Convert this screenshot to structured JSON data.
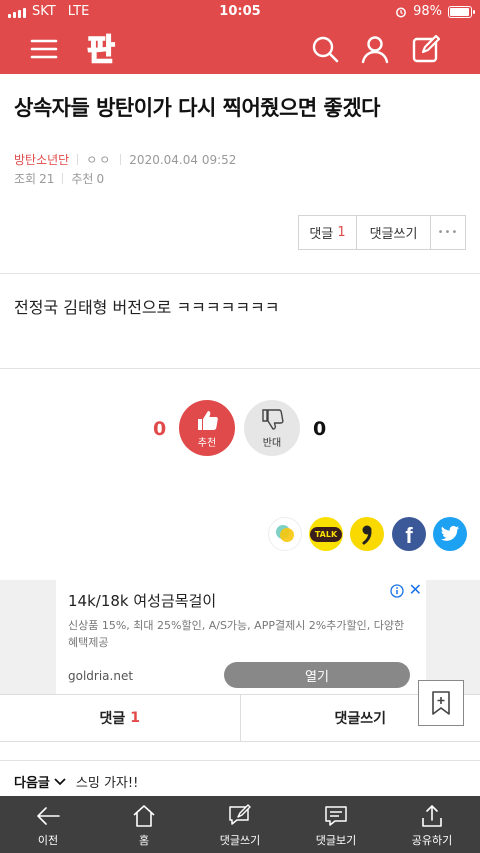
{
  "status_bar": {
    "carrier": "SKT",
    "network": "LTE",
    "time": "10:05",
    "battery": "98%",
    "battery_level": 0.98
  },
  "header": {
    "logo": "판",
    "icons": [
      "menu-icon",
      "search-icon",
      "user-icon",
      "write-icon"
    ]
  },
  "article": {
    "title": "상속자들 방탄이가 다시 찍어줬으면 좋겠다",
    "author": "방탄소년단",
    "nick": "ㅇㅇ",
    "date": "2020.04.04 09:52",
    "views_label": "조회",
    "views": "21",
    "recommend_label": "추천",
    "recommend": "0",
    "body": "전정국 김태형 버전으로 ㅋㅋㅋㅋㅋㅋㅋ"
  },
  "actions": {
    "comment_label": "댓글",
    "comment_count": "1",
    "write_comment": "댓글쓰기",
    "more": "•••"
  },
  "votes": {
    "up_count": "0",
    "up_label": "추천",
    "down_count": "0",
    "down_label": "반대"
  },
  "share": {
    "kakaostory": "kakaostory-icon",
    "kakaotalk": "TALK",
    "comma": "comma-icon",
    "facebook": "f",
    "twitter": "twitter-icon"
  },
  "ad": {
    "headline": "14k/18k 여성금목걸이",
    "desc": "신상품 15%, 최대 25%할인, A/S가능, APP결제시 2%추가할인, 다양한 혜택제공",
    "domain": "goldria.net",
    "open": "열기"
  },
  "comment_bar": {
    "comment_label": "댓글",
    "comment_count": "1",
    "write": "댓글쓰기"
  },
  "next": {
    "label": "다음글",
    "title": "스밍 가자!!"
  },
  "toolbar": {
    "items": [
      {
        "label": "이전",
        "icon": "back-arrow-icon"
      },
      {
        "label": "홈",
        "icon": "home-icon"
      },
      {
        "label": "댓글쓰기",
        "icon": "write-comment-icon"
      },
      {
        "label": "댓글보기",
        "icon": "view-comments-icon"
      },
      {
        "label": "공유하기",
        "icon": "share-icon"
      }
    ]
  },
  "colors": {
    "brand": "#e14a4a",
    "toolbar": "#3f3f3f",
    "facebook": "#3b5998",
    "twitter": "#1da1f2",
    "kakao": "#f9e000"
  }
}
